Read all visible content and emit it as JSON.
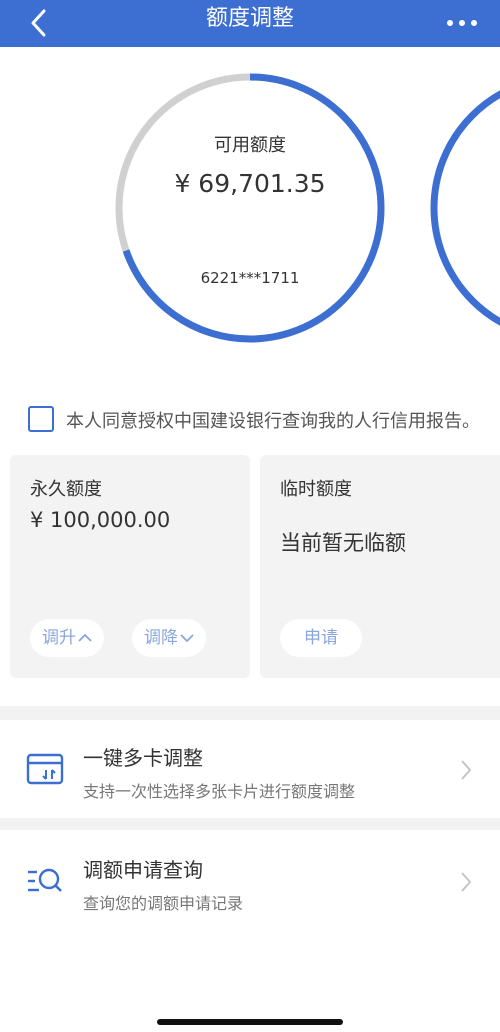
{
  "header": {
    "title": "额度调整",
    "back_icon": "chevron-left-icon",
    "more_icon": "more-dots-icon",
    "color": "#3c6fd1"
  },
  "credit_ring": {
    "label": "可用额度",
    "amount": "¥ 69,701.35",
    "card_number": "6221***1711",
    "available_fraction": 0.697,
    "ring_color": "#3c6fd1",
    "track_color": "#d0d0d0"
  },
  "consent": {
    "text": "本人同意授权中国建设银行查询我的人行信用报告。",
    "checked": false
  },
  "permanent_quota": {
    "title": "永久额度",
    "value": "¥ 100,000.00",
    "increase_label": "调升",
    "decrease_label": "调降"
  },
  "temporary_quota": {
    "title": "临时额度",
    "status": "当前暂无临额",
    "apply_label": "申请"
  },
  "menu": [
    {
      "title": "一键多卡调整",
      "subtitle": "支持一次性选择多张卡片进行额度调整",
      "icon": "multi-card-icon"
    },
    {
      "title": "调额申请查询",
      "subtitle": "查询您的调额申请记录",
      "icon": "search-list-icon"
    }
  ]
}
